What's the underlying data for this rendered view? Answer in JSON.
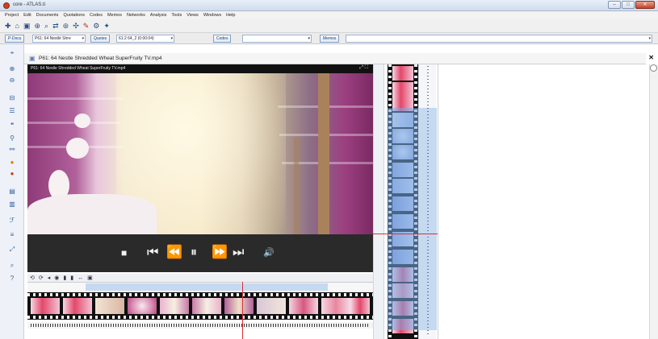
{
  "window": {
    "title": "core - ATLAS.ti",
    "controls": {
      "minimize": "–",
      "maximize": "□",
      "close": "✕"
    }
  },
  "menu": [
    "Project",
    "Edit",
    "Documents",
    "Quotations",
    "Codes",
    "Memos",
    "Networks",
    "Analysis",
    "Tools",
    "Views",
    "Windows",
    "Help"
  ],
  "toolbar2": {
    "pdocs_label": "P-Docs",
    "document_selector": "P61: 64 Nestlé Shre",
    "quotes_label": "Quotes",
    "quote_selector": "61:2 64_2 (0:00:04)",
    "codes_label": "Codes",
    "memos_label": "Memos"
  },
  "document_tab": {
    "title": "P61: 64 Nestle Shredded Wheat SuperFruity TV.mp4",
    "close": "✕"
  },
  "player": {
    "header_title": "P61: 64 Nestle Shredded Wheat SuperFruity TV.mp4",
    "header_icons": "⤢ ⛶",
    "controls": {
      "stop": "■",
      "prev": "⏮",
      "rewind": "⏪",
      "pause": "⏸",
      "forward": "⏩",
      "next": "⏭",
      "volume": "🔊"
    }
  },
  "transport_icons": [
    "⟲",
    "⟳",
    "◂",
    "◉",
    "▮",
    "▮",
    "↔",
    "▣"
  ],
  "colors": {
    "accent_blue": "#c5d9f1",
    "cursor_red": "#d8303a",
    "film_black": "#101010"
  }
}
